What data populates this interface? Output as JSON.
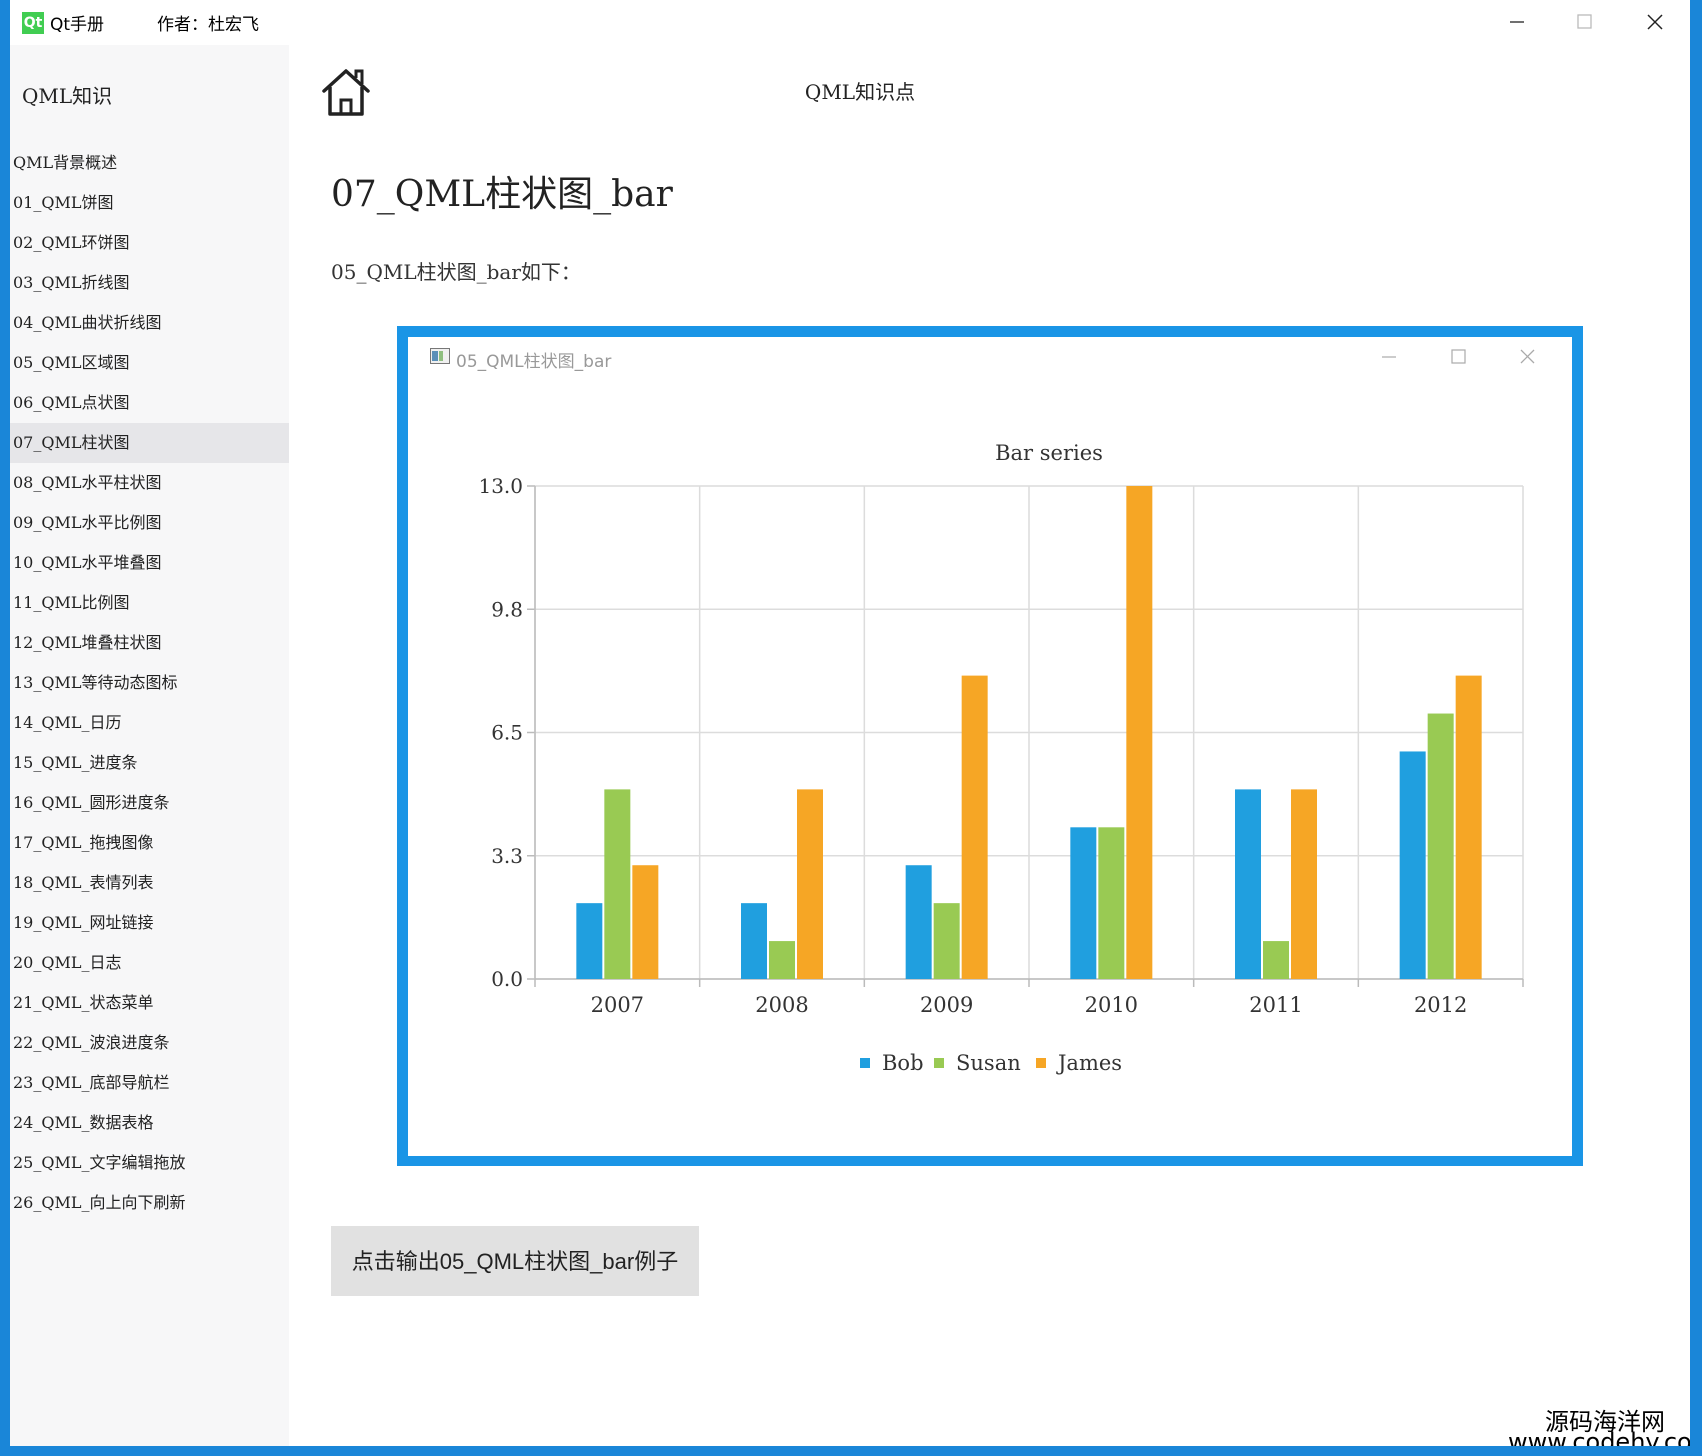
{
  "window": {
    "app_title": "Qt手册",
    "logo_text": "Qt",
    "author": "作者：杜宏飞"
  },
  "sidebar": {
    "title": "QML知识",
    "items": [
      {
        "label": "QML背景概述"
      },
      {
        "label": "01_QML饼图"
      },
      {
        "label": "02_QML环饼图"
      },
      {
        "label": "03_QML折线图"
      },
      {
        "label": "04_QML曲状折线图"
      },
      {
        "label": "05_QML区域图"
      },
      {
        "label": "06_QML点状图"
      },
      {
        "label": "07_QML柱状图",
        "active": true
      },
      {
        "label": "08_QML水平柱状图"
      },
      {
        "label": "09_QML水平比例图"
      },
      {
        "label": "10_QML水平堆叠图"
      },
      {
        "label": "11_QML比例图"
      },
      {
        "label": "12_QML堆叠柱状图"
      },
      {
        "label": "13_QML等待动态图标"
      },
      {
        "label": "14_QML_日历"
      },
      {
        "label": "15_QML_进度条"
      },
      {
        "label": "16_QML_圆形进度条"
      },
      {
        "label": "17_QML_拖拽图像"
      },
      {
        "label": "18_QML_表情列表"
      },
      {
        "label": "19_QML_网址链接"
      },
      {
        "label": "20_QML_日志"
      },
      {
        "label": "21_QML_状态菜单"
      },
      {
        "label": "22_QML_波浪进度条"
      },
      {
        "label": "23_QML_底部导航栏"
      },
      {
        "label": "24_QML_数据表格"
      },
      {
        "label": "25_QML_文字编辑拖放"
      },
      {
        "label": "26_QML_向上向下刷新"
      }
    ]
  },
  "header": {
    "title": "QML知识点",
    "home_icon": "home-icon"
  },
  "content": {
    "heading": "07_QML柱状图_bar",
    "intro": "05_QML柱状图_bar如下：",
    "button_label": "点击输出05_QML柱状图_bar例子"
  },
  "inner_window": {
    "title": "05_QML柱状图_bar"
  },
  "chart_data": {
    "type": "bar",
    "title": "Bar series",
    "categories": [
      "2007",
      "2008",
      "2009",
      "2010",
      "2011",
      "2012"
    ],
    "series": [
      {
        "name": "Bob",
        "color": "#209fdf",
        "values": [
          2,
          2,
          3,
          4,
          5,
          6
        ]
      },
      {
        "name": "Susan",
        "color": "#99ca53",
        "values": [
          5,
          1,
          2,
          4,
          1,
          7
        ]
      },
      {
        "name": "James",
        "color": "#f6a625",
        "values": [
          3,
          5,
          8,
          13,
          5,
          8
        ]
      }
    ],
    "ylim": [
      0,
      13
    ],
    "yticks": [
      "0.0",
      "3.3",
      "6.5",
      "9.8",
      "13.0"
    ],
    "grid": true,
    "legend_position": "bottom"
  },
  "watermark": {
    "line1": "源码海洋网",
    "line2": "www.codehy.com"
  }
}
